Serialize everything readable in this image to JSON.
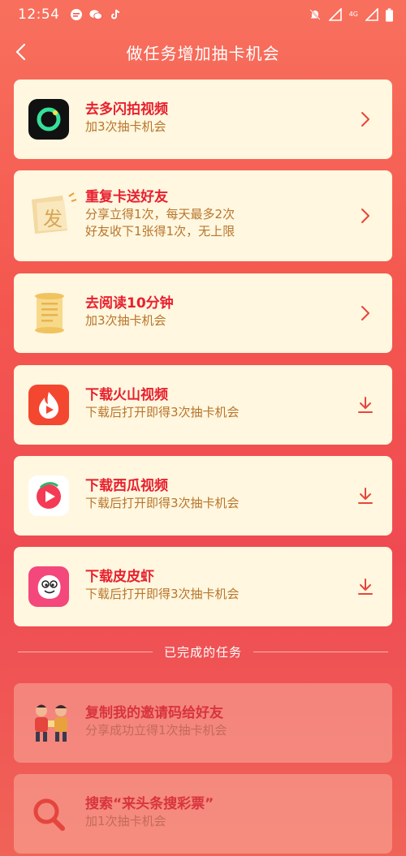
{
  "status": {
    "time": "12:54",
    "network_badge": "4G"
  },
  "header": {
    "title": "做任务增加抽卡机会"
  },
  "tasks": [
    {
      "title": "去多闪拍视频",
      "desc1": "加3次抽卡机会",
      "icon": "duoshan-app-icon",
      "action": "chevron-right-icon"
    },
    {
      "title": "重复卡送好友",
      "desc1": "分享立得1次，每天最多2次",
      "desc2": "好友收下1张得1次，无上限",
      "icon_char": "发",
      "icon": "fa-card-icon",
      "action": "chevron-right-icon"
    },
    {
      "title": "去阅读10分钟",
      "desc1": "加3次抽卡机会",
      "icon": "scroll-icon",
      "action": "chevron-right-icon"
    },
    {
      "title": "下载火山视频",
      "desc1": "下载后打开即得3次抽卡机会",
      "icon": "huoshan-app-icon",
      "action": "download-icon"
    },
    {
      "title": "下载西瓜视频",
      "desc1": "下载后打开即得3次抽卡机会",
      "icon": "xigua-app-icon",
      "action": "download-icon"
    },
    {
      "title": "下载皮皮虾",
      "desc1": "下载后打开即得3次抽卡机会",
      "icon": "pipixia-app-icon",
      "action": "download-icon"
    }
  ],
  "completed_label": "已完成的任务",
  "completed": [
    {
      "title": "复制我的邀请码给好友",
      "desc1": "分享成功立得1次抽卡机会",
      "icon": "friends-illustration-icon"
    },
    {
      "title": "搜索“来头条搜彩票”",
      "desc1": "加1次抽卡机会",
      "icon": "search-icon"
    }
  ],
  "colors": {
    "card_bg": "#fff7df",
    "title_red": "#e8202f",
    "desc_brown": "#b8752d",
    "accent_red": "#e8453c"
  }
}
